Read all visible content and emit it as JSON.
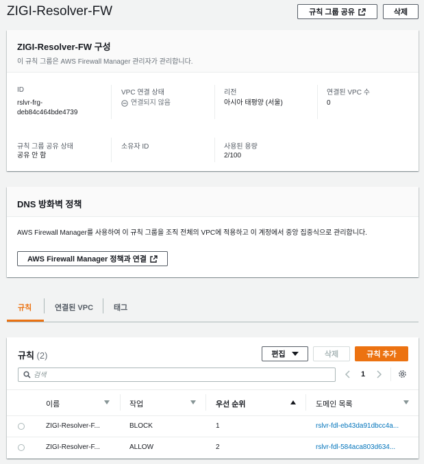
{
  "header": {
    "title": "ZIGI-Resolver-FW",
    "share_button": "규칙 그룹 공유",
    "delete_button": "삭제"
  },
  "config": {
    "title": "ZIGI-Resolver-FW 구성",
    "description": "이 규칙 그룹은 AWS Firewall Manager 관리자가 관리합니다.",
    "id_label": "ID",
    "id_value_line1": "rslvr-frg-",
    "id_value_line2": "deb84c464bde4739",
    "vpc_status_label": "VPC 연결 상태",
    "vpc_status_value": "연결되지 않음",
    "region_label": "리전",
    "region_value": "아시아 태평양 (서울)",
    "vpc_count_label": "연결된 VPC 수",
    "vpc_count_value": "0",
    "share_status_label": "규칙 그룹 공유 상태",
    "share_status_value": "공유 안 함",
    "owner_label": "소유자 ID",
    "owner_value": "",
    "capacity_label": "사용된 용량",
    "capacity_value": "2/100"
  },
  "dns_policy": {
    "title": "DNS 방화벽 정책",
    "description": "AWS Firewall Manager를 사용하여 이 규칙 그룹을 조직 전체의 VPC에 적용하고 이 계정에서 중앙 집중식으로 관리합니다.",
    "link_button": "AWS Firewall Manager 정책과 연결"
  },
  "tabs": [
    {
      "label": "규칙",
      "active": true
    },
    {
      "label": "연결된 VPC",
      "active": false
    },
    {
      "label": "태그",
      "active": false
    }
  ],
  "rules": {
    "title": "규칙",
    "count": "(2)",
    "edit_button": "편집",
    "delete_button": "삭제",
    "add_button": "규칙 추가",
    "search_placeholder": "검색",
    "page": "1",
    "columns": [
      "이름",
      "작업",
      "우선 순위",
      "도메인 목록"
    ],
    "rows": [
      {
        "name": "ZIGI-Resolver-F...",
        "action": "BLOCK",
        "priority": "1",
        "domain_list": "rslvr-fdl-eb43da91dbcc4a..."
      },
      {
        "name": "ZIGI-Resolver-F...",
        "action": "ALLOW",
        "priority": "2",
        "domain_list": "rslvr-fdl-584aca803d634..."
      }
    ]
  },
  "colors": {
    "accent": "#ec7211",
    "link": "#0073bb",
    "text": "#16191f",
    "muted": "#545b64"
  }
}
